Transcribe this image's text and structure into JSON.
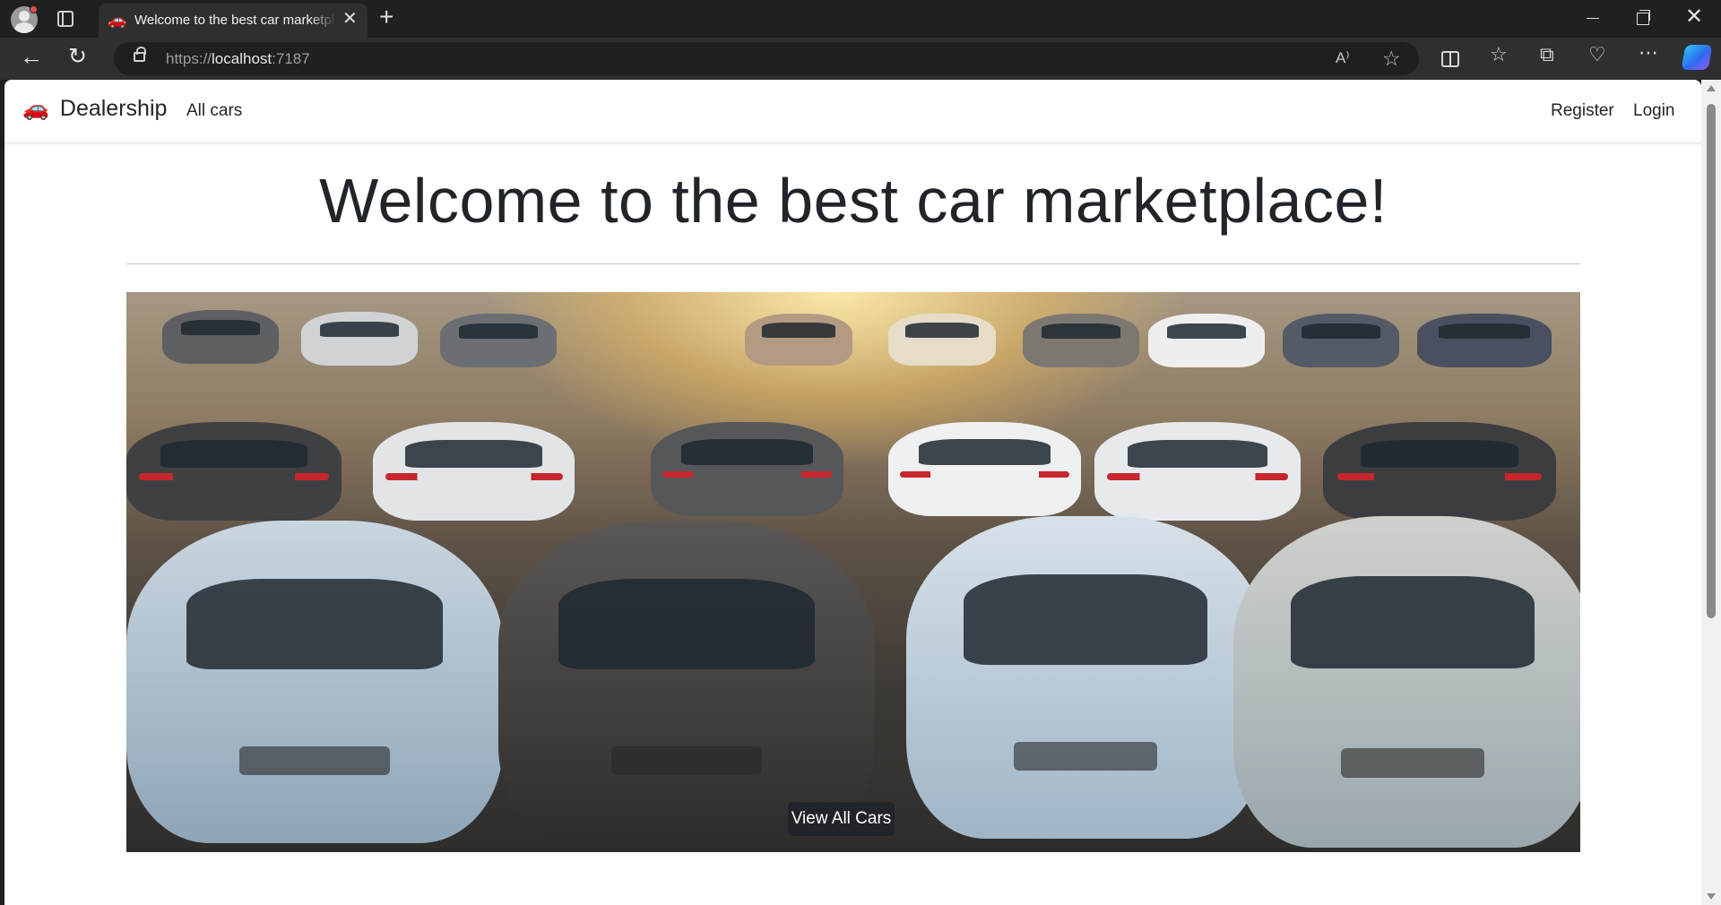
{
  "browser": {
    "tab_title": "Welcome to the best car marketplace!",
    "tab_favicon": "🚗",
    "url_scheme": "https://",
    "url_host": "localhost",
    "url_port": ":7187",
    "read_aloud_label": "A⁾",
    "icons": [
      "profile-icon",
      "tab-actions-icon",
      "close-icon",
      "new-tab-icon",
      "minimize-icon",
      "maximize-icon",
      "window-close-icon",
      "back-icon",
      "reload-icon",
      "lock-icon",
      "read-aloud-icon",
      "favorite-star-icon",
      "split-screen-icon",
      "favorites-icon",
      "collections-icon",
      "browser-essentials-icon",
      "more-icon",
      "copilot-icon"
    ]
  },
  "nav": {
    "brand_icon": "🚗",
    "brand": "Dealership",
    "all_cars": "All cars",
    "register": "Register",
    "login": "Login"
  },
  "main": {
    "title": "Welcome to the best car marketplace!",
    "button": "View All Cars"
  },
  "colors": {
    "text": "#212529",
    "button_bg": "#212529",
    "page_bg": "#ffffff",
    "chrome_bg": "#202020"
  }
}
